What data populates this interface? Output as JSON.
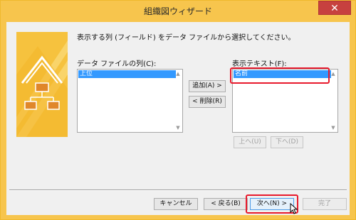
{
  "window": {
    "title": "組織図ウィザード",
    "close_glyph": "✕"
  },
  "instruction": "表示する列 (フィールド) をデータ ファイルから選択してください。",
  "source_list": {
    "label": "データ ファイルの列(C):",
    "items": [
      {
        "label": "上位",
        "selected": true
      }
    ]
  },
  "target_list": {
    "label": "表示テキスト(F):",
    "items": [
      {
        "label": "名前",
        "selected": true
      }
    ]
  },
  "buttons": {
    "add": "追加(A) >",
    "remove": "< 削除(R)",
    "up": "上へ(U)",
    "down": "下へ(D)",
    "cancel": "キャンセル",
    "back": "< 戻る(B)",
    "next": "次へ(N) >",
    "finish": "完了"
  },
  "scroll_glyphs": {
    "up": "▲",
    "down": "▼"
  },
  "colors": {
    "accent_frame": "#f7c54d",
    "selection": "#3399ff",
    "highlight": "#e8192c"
  }
}
